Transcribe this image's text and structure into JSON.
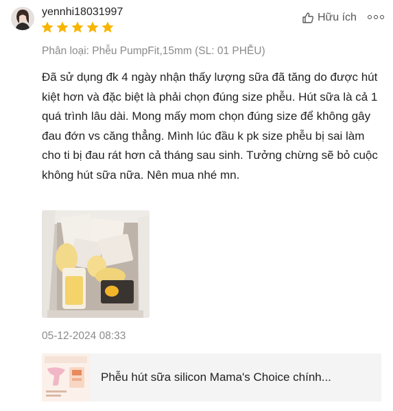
{
  "review": {
    "username": "yennhi18031997",
    "rating": 5,
    "helpful_label": "Hữu ích",
    "variation": "Phân loại: Phễu PumpFit,15mm (SL: 01 PHỄU)",
    "text": "Đã sử dụng đk 4 ngày nhận thấy lượng sữa đã tăng do được hút kiệt hơn và đặc biệt là phải chọn đúng size phễu. Hút sữa là cả 1 quá trình lâu dài. Mong mấy mom chọn đúng size để không gây đau đớn vs căng thẳng. Mình lúc đầu k pk size phễu bị sai làm cho ti bị đau rát hơn cả tháng sau sinh. Tưởng chừng sẽ bỏ cuộc không hút sữa nữa. Nên mua nhé mn.",
    "date": "05-12-2024 08:33"
  },
  "product": {
    "name": "Phễu hút sữa silicon Mama's Choice chính..."
  },
  "colors": {
    "star": "#f7b500",
    "muted_text": "#8a8a8a",
    "product_bg": "#f4f4f4"
  },
  "icons": {
    "helpful": "thumbs-up-icon",
    "more": "more-options-icon",
    "star": "star-icon"
  }
}
